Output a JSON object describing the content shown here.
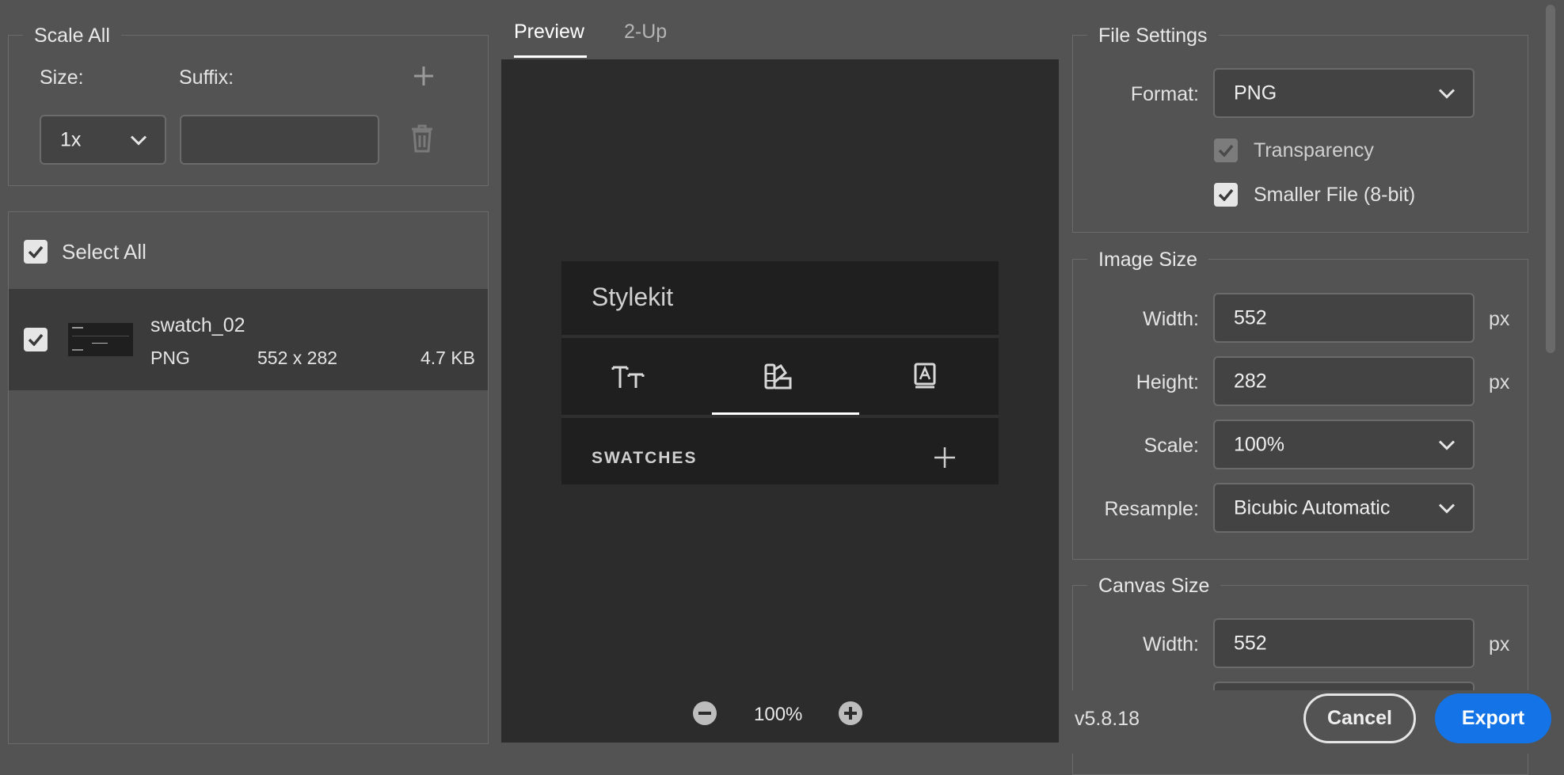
{
  "scale_all": {
    "legend": "Scale All",
    "size_label": "Size:",
    "suffix_label": "Suffix:",
    "size_value": "1x",
    "suffix_value": ""
  },
  "assets": {
    "select_all_label": "Select All",
    "items": [
      {
        "name": "swatch_02",
        "format": "PNG",
        "dimensions": "552 x 282",
        "file_size": "4.7 KB",
        "checked": true
      }
    ]
  },
  "preview": {
    "tabs": [
      {
        "label": "Preview",
        "active": true
      },
      {
        "label": "2-Up",
        "active": false
      }
    ],
    "zoom": "100%",
    "panel": {
      "title": "Stylekit",
      "section_label": "SWATCHES",
      "active_tab_index": 1
    }
  },
  "file_settings": {
    "legend": "File Settings",
    "format_label": "Format:",
    "format_value": "PNG",
    "transparency_label": "Transparency",
    "smaller_file_label": "Smaller File (8-bit)"
  },
  "image_size": {
    "legend": "Image Size",
    "width_label": "Width:",
    "width_value": "552",
    "height_label": "Height:",
    "height_value": "282",
    "scale_label": "Scale:",
    "scale_value": "100%",
    "resample_label": "Resample:",
    "resample_value": "Bicubic Automatic",
    "unit": "px"
  },
  "canvas_size": {
    "legend": "Canvas Size",
    "width_label": "Width:",
    "width_value": "552",
    "unit": "px"
  },
  "footer": {
    "version": "v5.8.18",
    "cancel_label": "Cancel",
    "export_label": "Export"
  },
  "colors": {
    "background": "#535353",
    "preview_bg": "#2c2c2c",
    "accent": "#1473e6"
  }
}
